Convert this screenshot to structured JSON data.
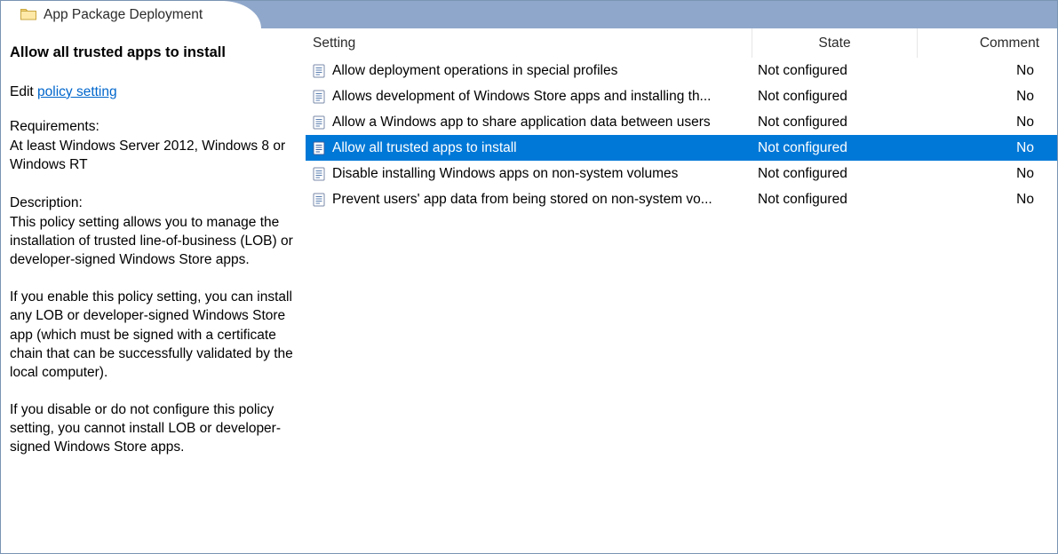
{
  "titlebar": {
    "title": "App Package Deployment"
  },
  "left": {
    "selected_title": "Allow all trusted apps to install",
    "edit_prefix": "Edit ",
    "edit_link": "policy setting ",
    "requirements_label": "Requirements:",
    "requirements_text": "At least Windows Server 2012, Windows 8 or Windows RT",
    "description_label": "Description:",
    "description_p1": "This policy setting allows you to manage the installation of trusted line-of-business (LOB) or developer-signed Windows Store apps.",
    "description_p2": "If you enable this policy setting, you can install any LOB or developer-signed Windows Store app (which must be signed with a certificate chain that can be successfully validated by the local computer).",
    "description_p3": "If you disable or do not configure this policy setting, you cannot install LOB or developer-signed Windows Store apps."
  },
  "columns": {
    "setting": "Setting",
    "state": "State",
    "comment": "Comment"
  },
  "rows": [
    {
      "setting": "Allow deployment operations in special profiles",
      "state": "Not configured",
      "comment": "No",
      "selected": false
    },
    {
      "setting": "Allows development of Windows Store apps and installing th...",
      "state": "Not configured",
      "comment": "No",
      "selected": false
    },
    {
      "setting": "Allow a Windows app to share application data between users",
      "state": "Not configured",
      "comment": "No",
      "selected": false
    },
    {
      "setting": "Allow all trusted apps to install",
      "state": "Not configured",
      "comment": "No",
      "selected": true
    },
    {
      "setting": "Disable installing Windows apps on non-system volumes",
      "state": "Not configured",
      "comment": "No",
      "selected": false
    },
    {
      "setting": "Prevent users' app data from being stored on non-system vo...",
      "state": "Not configured",
      "comment": "No",
      "selected": false
    }
  ]
}
